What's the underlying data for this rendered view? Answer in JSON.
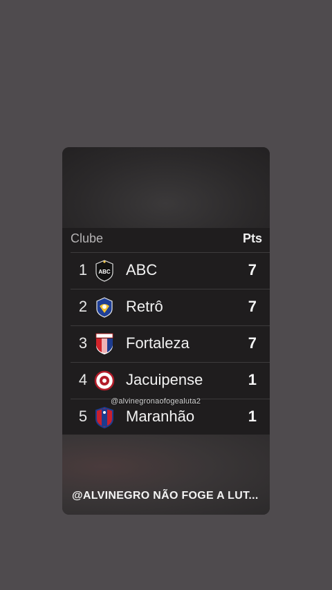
{
  "table": {
    "header": {
      "club": "Clube",
      "points": "Pts"
    },
    "rows": [
      {
        "pos": "1",
        "name": "ABC",
        "pts": "7",
        "crest": "abc-crest-icon"
      },
      {
        "pos": "2",
        "name": "Retrô",
        "pts": "7",
        "crest": "retro-crest-icon"
      },
      {
        "pos": "3",
        "name": "Fortaleza",
        "pts": "7",
        "crest": "fortaleza-crest-icon"
      },
      {
        "pos": "4",
        "name": "Jacuipense",
        "pts": "1",
        "crest": "jacuipense-crest-icon"
      },
      {
        "pos": "5",
        "name": "Maranhão",
        "pts": "1",
        "crest": "maranhao-crest-icon"
      }
    ]
  },
  "watermark": "@alvinegronaofogealuta2",
  "caption": "@ALVINEGRO NÃO FOGE A LUT...",
  "colors": {
    "background": "#4f4b4e",
    "card": "#2a2829",
    "table": "#1f1d1e",
    "text": "#f2f2f2"
  }
}
